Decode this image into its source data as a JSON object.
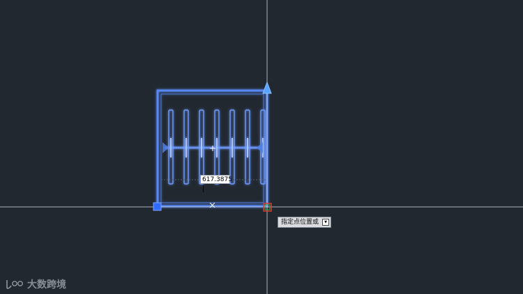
{
  "drawing": {
    "dynamic_input_value": "617.3875",
    "command_prompt_text": "指定点位置或",
    "command_prompt_dropdown_icon": "chevron-down-icon"
  },
  "watermark": {
    "text": "大数跨境",
    "logo_icon": "brand-logo-icon"
  },
  "colors": {
    "background": "#212830",
    "selection_blue": "#5b8cff",
    "grip_blue": "#2f6bff",
    "crosshair": "#c9ced6",
    "osnap_marker": "#d93a2b"
  }
}
